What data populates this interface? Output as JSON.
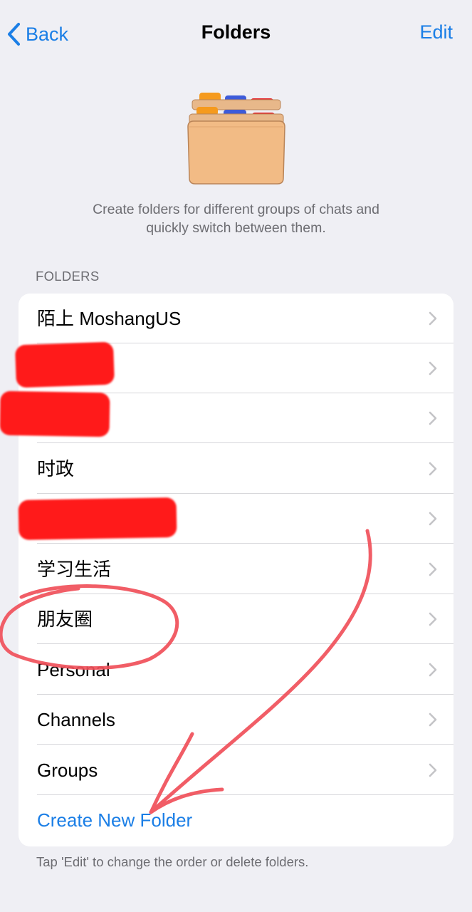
{
  "navbar": {
    "back_label": "Back",
    "title": "Folders",
    "edit_label": "Edit"
  },
  "intro": {
    "description_line1": "Create folders for different groups of chats and",
    "description_line2": "quickly switch between them."
  },
  "section": {
    "header": "FOLDERS"
  },
  "folders": [
    {
      "label": "陌上 MoshangUS"
    },
    {
      "label": ""
    },
    {
      "label": ""
    },
    {
      "label": "时政"
    },
    {
      "label": ""
    },
    {
      "label": "学习生活"
    },
    {
      "label": "朋友圈"
    },
    {
      "label": "Personal"
    },
    {
      "label": "Channels"
    },
    {
      "label": "Groups"
    }
  ],
  "create_label": "Create New Folder",
  "footer_note": "Tap 'Edit' to change the order or delete folders.",
  "colors": {
    "accent": "#1a7ee6",
    "background": "#efeff4",
    "redaction": "#ff1a1a",
    "annotation": "#f0505a"
  }
}
